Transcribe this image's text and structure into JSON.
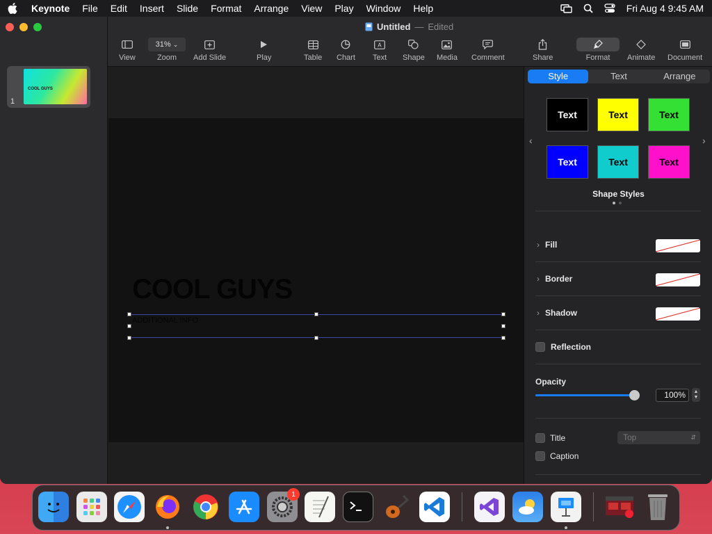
{
  "menubar": {
    "app_name": "Keynote",
    "items": [
      "File",
      "Edit",
      "Insert",
      "Slide",
      "Format",
      "Arrange",
      "View",
      "Play",
      "Window",
      "Help"
    ],
    "datetime": "Fri Aug 4  9:45 AM"
  },
  "window": {
    "title": "Untitled",
    "separator": "—",
    "status": "Edited"
  },
  "toolbar": {
    "view": "View",
    "zoom_value": "31%",
    "zoom": "Zoom",
    "add_slide": "Add Slide",
    "play": "Play",
    "table": "Table",
    "chart": "Chart",
    "text": "Text",
    "shape": "Shape",
    "media": "Media",
    "comment": "Comment",
    "share": "Share",
    "format": "Format",
    "animate": "Animate",
    "document": "Document"
  },
  "navigator": {
    "slide_number": "1",
    "thumb_text": "COOL GUYS"
  },
  "slide": {
    "title": "COOL GUYS",
    "subtitle": "ADDITIONAL INFO"
  },
  "inspector": {
    "tabs": [
      "Style",
      "Text",
      "Arrange"
    ],
    "active_tab": "Style",
    "swatches": [
      {
        "label": "Text",
        "bg": "#000000",
        "fg": "#ffffff"
      },
      {
        "label": "Text",
        "bg": "#ffff00",
        "fg": "#000000"
      },
      {
        "label": "Text",
        "bg": "#33e033",
        "fg": "#000000"
      },
      {
        "label": "Text",
        "bg": "#0000ff",
        "fg": "#ffffff"
      },
      {
        "label": "Text",
        "bg": "#11cccc",
        "fg": "#000000"
      },
      {
        "label": "Text",
        "bg": "#ff11cc",
        "fg": "#000000"
      }
    ],
    "shape_styles": "Shape Styles",
    "fill": "Fill",
    "border": "Border",
    "shadow": "Shadow",
    "reflection": "Reflection",
    "opacity_label": "Opacity",
    "opacity_value": "100%",
    "opacity": 1.0,
    "title_cb": "Title",
    "title_position": "Top",
    "caption_cb": "Caption"
  },
  "dock": {
    "apps": [
      "Finder",
      "Launchpad",
      "Safari",
      "Firefox",
      "Chrome",
      "App Store",
      "System Settings",
      "TextEdit",
      "Terminal",
      "GarageBand",
      "Visual Studio Code",
      "Visual Studio",
      "Weather",
      "Keynote",
      "Screen Sharing",
      "Trash"
    ],
    "settings_badge": "1"
  },
  "colors": {
    "accent": "#1a7cf5",
    "wallpaper": "#c8283a"
  }
}
